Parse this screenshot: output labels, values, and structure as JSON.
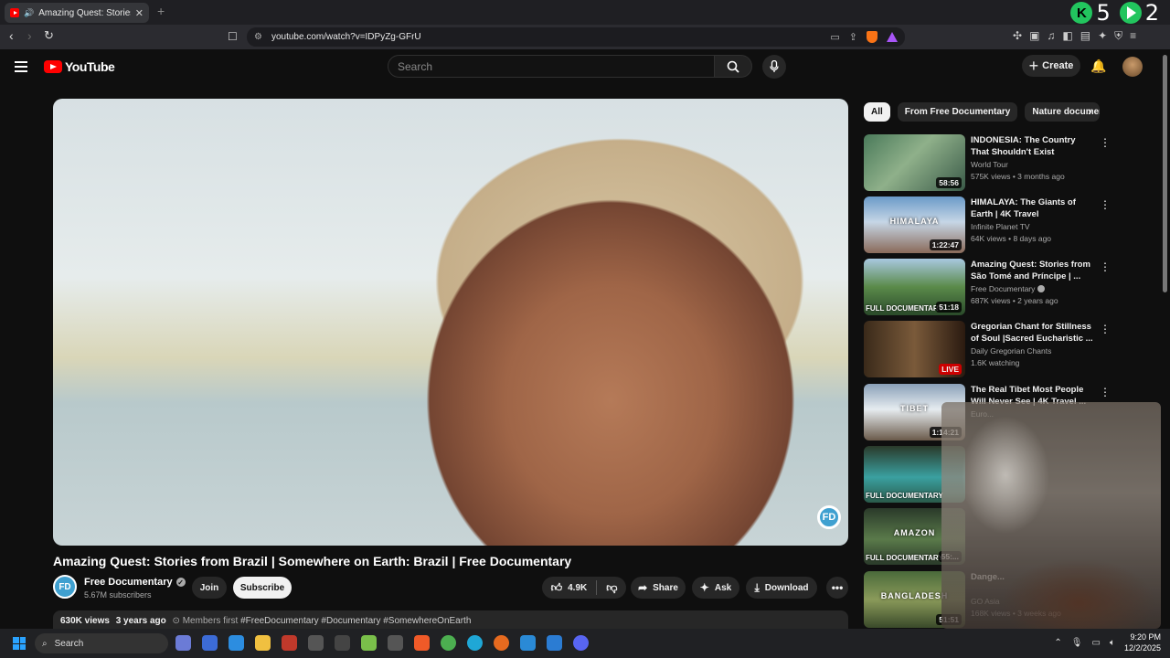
{
  "browser": {
    "tab_title": "Amazing Quest: Stories from",
    "new_tab": "+",
    "counter_k": "5",
    "counter_p": "2",
    "url": "youtube.com/watch?v=IDPyZg-GFrU",
    "brave_badge": "9",
    "alert_badge": "1"
  },
  "yt": {
    "logo": "YouTube",
    "search_placeholder": "Search",
    "create_label": "Create"
  },
  "video": {
    "title": "Amazing Quest: Stories from Brazil | Somewhere on Earth: Brazil | Free Documentary",
    "channel": "Free Documentary",
    "subscribers": "5.67M subscribers",
    "join": "Join",
    "subscribe": "Subscribe",
    "likes": "4.9K",
    "share": "Share",
    "ask": "Ask",
    "download": "Download",
    "views": "630K views",
    "age": "3 years ago",
    "members": "Members first",
    "tags": "#FreeDocumentary #Documentary #SomewhereOnEarth",
    "watermark": "FD"
  },
  "chips": [
    "All",
    "From Free Documentary",
    "Nature documen"
  ],
  "suggestions": [
    {
      "title": "INDONESIA: The Country That Shouldn't Exist",
      "channel": "World Tour",
      "meta": "575K views • 3 months ago",
      "duration": "58:56",
      "bg": "linear-gradient(135deg,#4a7a5a,#8fb08a 45%,#3a5a48)"
    },
    {
      "title": "HIMALAYA: The Giants of Earth | 4K Travel Documentary",
      "channel": "Infinite Planet TV",
      "meta": "64K views • 8 days ago",
      "duration": "1:22:47",
      "overlay": "HIMALAYA",
      "bg": "linear-gradient(180deg,#6a9ac8,#c6d6e6 45%,#8a6a5a)"
    },
    {
      "title": "Amazing Quest: Stories from São Tomé and Príncipe | ...",
      "channel": "Free Documentary",
      "verified": true,
      "meta": "687K views • 2 years ago",
      "duration": "51:18",
      "badge": "FULL DOCUMENTARY",
      "bg": "linear-gradient(180deg,#a8c8e0,#5a8a4a 50%,#2a4a2a)"
    },
    {
      "title": "Gregorian Chant for Stillness of Soul |Sacred Eucharistic ...",
      "channel": "Daily Gregorian Chants",
      "meta": "1.6K watching",
      "live": "LIVE",
      "bg": "linear-gradient(90deg,#3a2a1a,#7a5a3a 50%,#2a1a10)"
    },
    {
      "title": "The Real Tibet Most People Will Never See | 4K Travel ...",
      "channel": "Euro...",
      "meta": "",
      "duration": "1:14:21",
      "overlay": "TIBET",
      "bg": "linear-gradient(180deg,#8aa0b8,#e6ecf0 45%,#6a5a4a)"
    },
    {
      "title": "",
      "channel": "",
      "meta": "",
      "badge": "FULL DOCUMENTARY",
      "bg": "linear-gradient(180deg,#2a3a2a,#3aa0a0 55%,#2a5a4a)"
    },
    {
      "title": "",
      "channel": "",
      "meta": "",
      "duration": "55:...",
      "badge": "FULL DOCUMENTARY",
      "overlay": "AMAZON",
      "bg": "linear-gradient(180deg,#2a3a2a,#5a7a4a 55%,#2a3a2a)"
    },
    {
      "title": "Dange...",
      "channel": "GO Asia",
      "meta": "168K views • 3 weeks ago",
      "duration": "51:51",
      "overlay": "BANGLADESH",
      "bg": "linear-gradient(180deg,#4a6a3a,#8a9a5a 50%,#3a4a2a)"
    }
  ],
  "taskbar": {
    "search": "Search",
    "time": "9:20 PM",
    "date": "12/2/2025"
  }
}
